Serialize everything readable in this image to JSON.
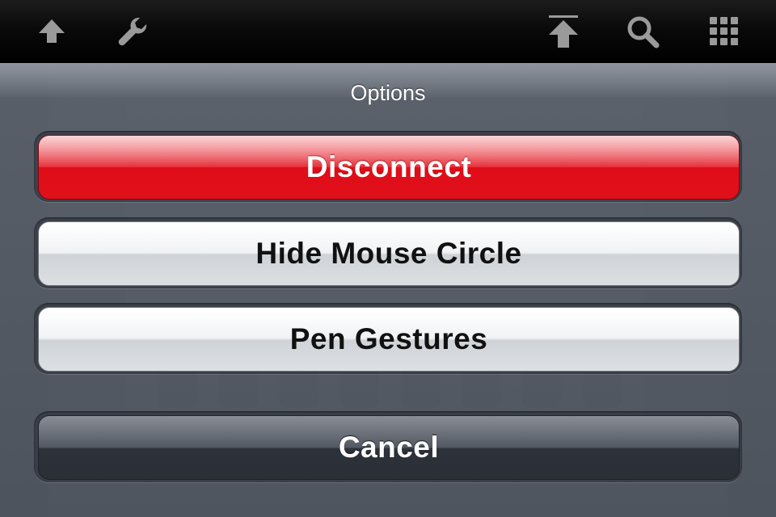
{
  "toolbar": {
    "icons": [
      "upload-icon",
      "wrench-icon",
      "send-up-icon",
      "search-icon",
      "grid-icon"
    ]
  },
  "sheet": {
    "title": "Options",
    "buttons": {
      "disconnect": "Disconnect",
      "hide_mouse_circle": "Hide Mouse Circle",
      "pen_gestures": "Pen Gestures",
      "cancel": "Cancel"
    }
  },
  "colors": {
    "destructive": "#e00d18",
    "sheet_background": "#4e545e",
    "toolbar": "#000000"
  }
}
